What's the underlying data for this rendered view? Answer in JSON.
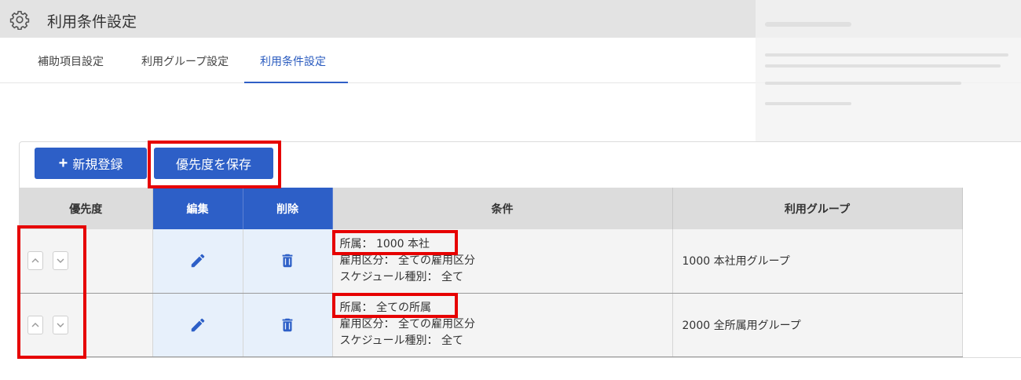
{
  "header": {
    "title": "利用条件設定",
    "icon": "gear-icon"
  },
  "tabs": [
    {
      "label": "補助項目設定"
    },
    {
      "label": "利用グループ設定"
    },
    {
      "label": "利用条件設定",
      "active": true
    }
  ],
  "toolbar": {
    "new_label": "新規登録",
    "save_priority_label": "優先度を保存"
  },
  "table": {
    "headers": {
      "priority": "優先度",
      "edit": "編集",
      "delete": "削除",
      "condition": "条件",
      "group": "利用グループ"
    },
    "rows": [
      {
        "condition": {
          "affiliation": "所属： 1000 本社",
          "employment": "雇用区分： 全ての雇用区分",
          "schedule": "スケジュール種別： 全て"
        },
        "group": "1000 本社用グループ"
      },
      {
        "condition": {
          "affiliation": "所属： 全ての所属",
          "employment": "雇用区分： 全ての雇用区分",
          "schedule": "スケジュール種別： 全て"
        },
        "group": "2000 全所属用グループ"
      }
    ]
  },
  "colors": {
    "primary": "#2d5fc7",
    "highlight": "#e60000",
    "edit_cell_bg": "#e7f0fb"
  }
}
